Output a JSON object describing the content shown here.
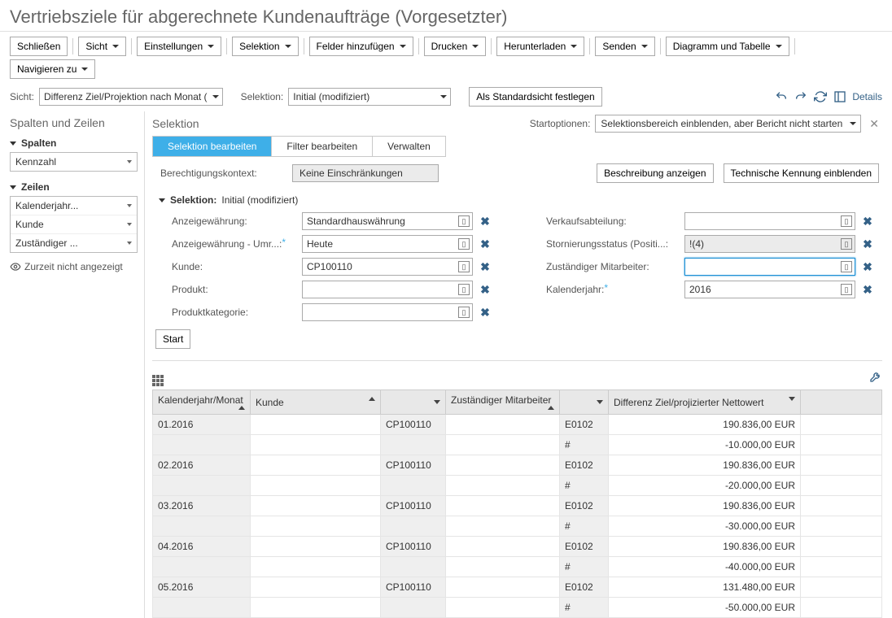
{
  "title": "Vertriebsziele für abgerechnete Kundenaufträge (Vorgesetzter)",
  "toolbar": {
    "close": "Schließen",
    "view": "Sicht",
    "settings": "Einstellungen",
    "selection": "Selektion",
    "add_fields": "Felder hinzufügen",
    "print": "Drucken",
    "download": "Herunterladen",
    "send": "Senden",
    "chart_table": "Diagramm und Tabelle",
    "navigate": "Navigieren zu"
  },
  "subbar": {
    "view_label": "Sicht:",
    "view_value": "Differenz Ziel/Projektion nach Monat (",
    "selection_label": "Selektion:",
    "selection_value": "Initial (modifiziert)",
    "set_default": "Als Standardsicht festlegen",
    "details": "Details"
  },
  "sidebar": {
    "title": "Spalten und Zeilen",
    "columns_label": "Spalten",
    "columns_items": [
      "Kennzahl"
    ],
    "rows_label": "Zeilen",
    "rows_items": [
      "Kalenderjahr...",
      "Kunde",
      "Zuständiger ..."
    ],
    "not_shown": "Zurzeit nicht angezeigt"
  },
  "main": {
    "selection_title": "Selektion",
    "start_options_label": "Startoptionen:",
    "start_options_value": "Selektionsbereich einblenden, aber Bericht nicht starten",
    "tabs": {
      "edit_selection": "Selektion bearbeiten",
      "edit_filter": "Filter bearbeiten",
      "manage": "Verwalten"
    },
    "auth_context_label": "Berechtigungskontext:",
    "auth_context_value": "Keine Einschränkungen",
    "show_desc": "Beschreibung anzeigen",
    "show_tech": "Technische Kennung einblenden",
    "sel_header_label": "Selektion:",
    "sel_header_value": "Initial (modifiziert)",
    "fields": {
      "display_currency_label": "Anzeigewährung:",
      "display_currency_value": "Standardhauswährung",
      "display_currency_rate_label": "Anzeigewährung - Umr...:",
      "display_currency_rate_value": "Heute",
      "customer_label": "Kunde:",
      "customer_value": "CP100110",
      "product_label": "Produkt:",
      "product_value": "",
      "product_cat_label": "Produktkategorie:",
      "product_cat_value": "",
      "sales_unit_label": "Verkaufsabteilung:",
      "sales_unit_value": "",
      "cancel_status_label": "Stornierungsstatus (Positi...:",
      "cancel_status_value": "!(4)",
      "responsible_label": "Zuständiger Mitarbeiter:",
      "responsible_value": "",
      "year_label": "Kalenderjahr:",
      "year_value": "2016"
    },
    "start_btn": "Start"
  },
  "table": {
    "headers": {
      "month": "Kalenderjahr/Monat",
      "customer": "Kunde",
      "customer_code": "",
      "responsible": "Zuständiger Mitarbeiter",
      "resp_code": "",
      "diff": "Differenz Ziel/projizierter Nettowert"
    },
    "rows": [
      {
        "month": "01.2016",
        "cust": "",
        "code": "CP100110",
        "resp": "",
        "rc": "E0102",
        "val": "190.836,00 EUR"
      },
      {
        "month": "",
        "cust": "",
        "code": "",
        "resp": "",
        "rc": "#",
        "val": "-10.000,00 EUR"
      },
      {
        "month": "02.2016",
        "cust": "",
        "code": "CP100110",
        "resp": "",
        "rc": "E0102",
        "val": "190.836,00 EUR"
      },
      {
        "month": "",
        "cust": "",
        "code": "",
        "resp": "",
        "rc": "#",
        "val": "-20.000,00 EUR"
      },
      {
        "month": "03.2016",
        "cust": "",
        "code": "CP100110",
        "resp": "",
        "rc": "E0102",
        "val": "190.836,00 EUR"
      },
      {
        "month": "",
        "cust": "",
        "code": "",
        "resp": "",
        "rc": "#",
        "val": "-30.000,00 EUR"
      },
      {
        "month": "04.2016",
        "cust": "",
        "code": "CP100110",
        "resp": "",
        "rc": "E0102",
        "val": "190.836,00 EUR"
      },
      {
        "month": "",
        "cust": "",
        "code": "",
        "resp": "",
        "rc": "#",
        "val": "-40.000,00 EUR"
      },
      {
        "month": "05.2016",
        "cust": "",
        "code": "CP100110",
        "resp": "",
        "rc": "E0102",
        "val": "131.480,00 EUR"
      },
      {
        "month": "",
        "cust": "",
        "code": "",
        "resp": "",
        "rc": "#",
        "val": "-50.000,00 EUR"
      }
    ]
  }
}
